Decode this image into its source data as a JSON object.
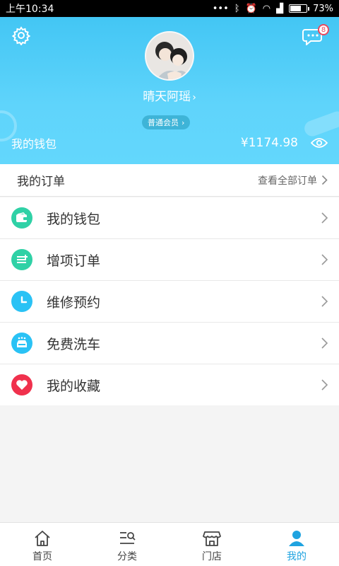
{
  "status_bar": {
    "time": "上午10:34",
    "battery": "73%",
    "battery_level": 0.73
  },
  "profile": {
    "username": "晴天阿瑶",
    "member_level": "普通会员",
    "message_badge": "8"
  },
  "wallet": {
    "label": "我的钱包",
    "amount": "¥1174.98"
  },
  "orders": {
    "title": "我的订单",
    "view_all": "查看全部订单"
  },
  "menu": [
    {
      "label": "我的钱包",
      "icon": "wallet-icon",
      "color": "#2fd1a6"
    },
    {
      "label": "增项订单",
      "icon": "list-add-icon",
      "color": "#2fd1a6"
    },
    {
      "label": "维修预约",
      "icon": "clock-icon",
      "color": "#2ac2f5"
    },
    {
      "label": "免费洗车",
      "icon": "car-wash-icon",
      "color": "#2ac2f5"
    },
    {
      "label": "我的收藏",
      "icon": "heart-icon",
      "color": "#f0314d"
    }
  ],
  "tabs": [
    {
      "label": "首页",
      "icon": "home-icon"
    },
    {
      "label": "分类",
      "icon": "category-icon"
    },
    {
      "label": "门店",
      "icon": "store-icon"
    },
    {
      "label": "我的",
      "icon": "profile-icon",
      "active": true
    }
  ],
  "colors": {
    "header": "#5fd4fb",
    "accent": "#1fa3e0",
    "heart": "#f0314d",
    "green": "#2fd1a6"
  }
}
